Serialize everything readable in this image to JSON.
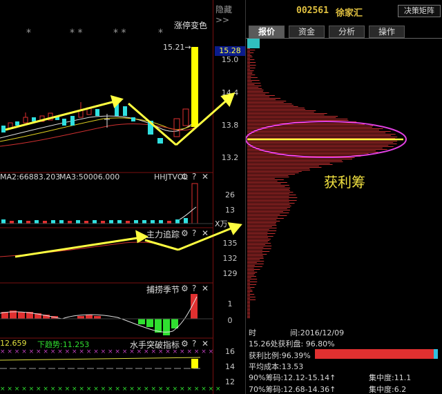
{
  "header": {
    "hide_label": "隐藏>>",
    "stock_code": "002561",
    "stock_name": "徐家汇",
    "decision_button": "决策矩阵"
  },
  "tabs": [
    {
      "label": "报价",
      "active": true
    },
    {
      "label": "资金",
      "active": false
    },
    {
      "label": "分析",
      "active": false
    },
    {
      "label": "操作",
      "active": false
    }
  ],
  "main_pane": {
    "title": "涨停变色",
    "stars": [
      "*",
      "* *",
      "* *",
      "*"
    ],
    "peak_label": "15.21→",
    "current_price": "15.28",
    "price_ticks": [
      "15.0",
      "14.4",
      "13.8",
      "13.2"
    ]
  },
  "volume_pane": {
    "ma2_label": "MA2:66883.203",
    "ma3_label": "MA3:50006.000",
    "indicator_name": "HHJTVOL",
    "ticks": [
      "26",
      "13"
    ],
    "unit": "X万"
  },
  "trend_pane": {
    "indicator_name": "主力追踪",
    "ticks": [
      "135",
      "132",
      "129"
    ]
  },
  "season_pane": {
    "indicator_name": "捕捞季节",
    "ticks": [
      "1",
      "0"
    ]
  },
  "breakout_pane": {
    "value_label": "12.659",
    "down_trend_label": "下趋势:11.253",
    "indicator_name": "水手突破指标",
    "ticks": [
      "16",
      "14",
      "12"
    ]
  },
  "chip_panel": {
    "profit_chip_label": "获利筹",
    "time_label": "时",
    "time_value": "间:2016/12/09",
    "profit_plate": "15.26处获利盘:  96.80%",
    "profit_ratio_label": "获利比例:96.39%",
    "avg_cost": "平均成本:13.53",
    "chip90": "90%筹码:12.12-15.14↑",
    "conc90": "集中度:11.1",
    "chip70": "70%筹码:12.68-14.36↑",
    "conc70": "集中度:6.2",
    "profit_ratio": 0.9639
  },
  "icons": {
    "gear": "gear-icon",
    "help": "question-icon",
    "close": "close-icon"
  },
  "colors": {
    "up": "#e03030",
    "down": "#30e0e0",
    "limit_up": "#ffff00",
    "arrow": "#ffff40",
    "ellipse": "#e040e0",
    "chip_bar": "#c83030"
  }
}
